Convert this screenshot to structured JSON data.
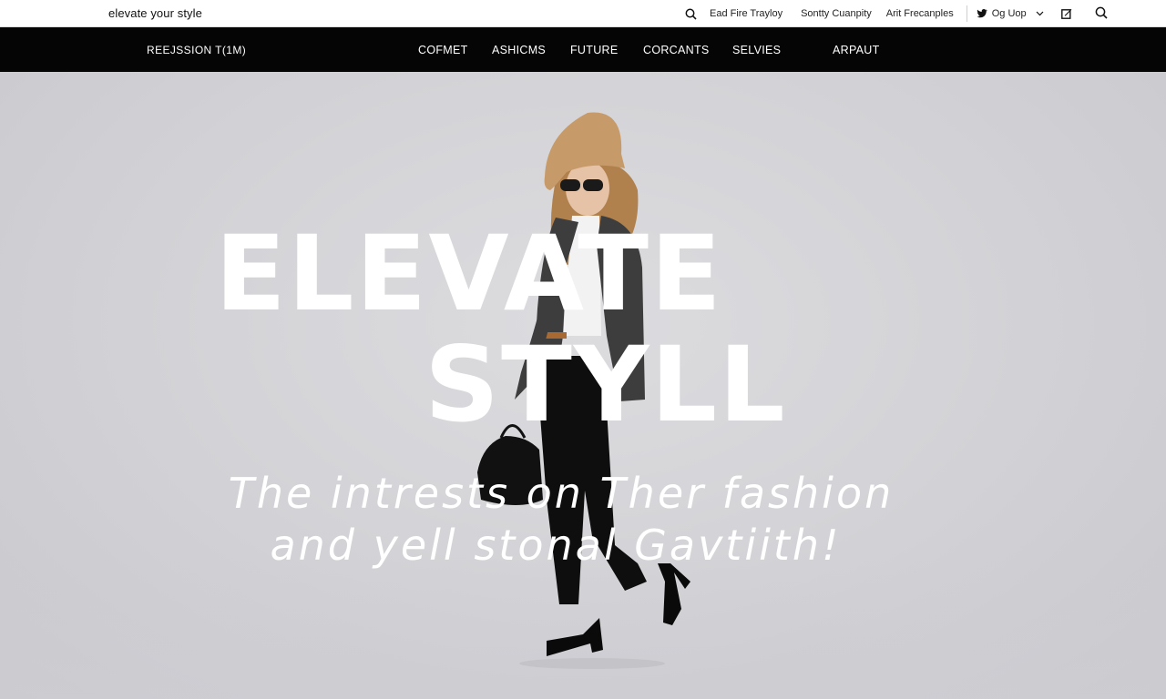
{
  "utility_bar": {
    "site_name": "elevate your style",
    "search_label": "Ead Fire Trayloy",
    "community_label": "Sontty Cuanpity",
    "preferences_label": "Arit Frecanples",
    "social_label": "Og Uop"
  },
  "main_nav": {
    "brand": "REEJSSION T(1M)",
    "items": [
      {
        "label": "COFMET"
      },
      {
        "label": "ASHICMS"
      },
      {
        "label": "FUTURE"
      },
      {
        "label": "CORCANTS"
      },
      {
        "label": "SELVIES"
      },
      {
        "label": "ARPAUT"
      }
    ]
  },
  "hero": {
    "headline_line1": "ELEVATE",
    "headline_line2": "STYLL",
    "tagline_line1": "The intrests on Ther fashion",
    "tagline_line2": "and yell stonal Gavtiith!"
  },
  "colors": {
    "nav_background": "#050505",
    "utility_background": "#ffffff",
    "hero_background": "#d4d4d8",
    "headline_text": "#ffffff"
  },
  "icons": [
    "search-icon",
    "twitter-icon",
    "chevron-down-icon",
    "edit-icon"
  ]
}
